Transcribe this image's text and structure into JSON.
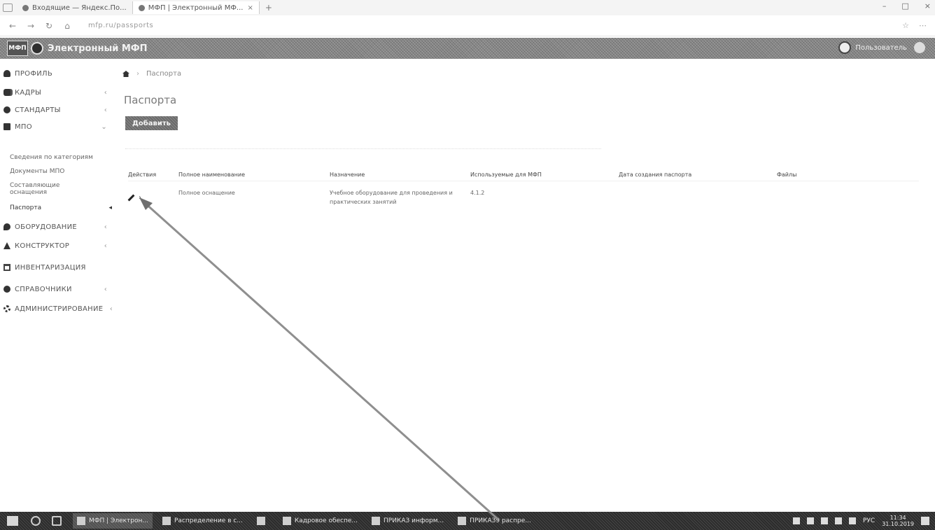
{
  "browser": {
    "tabs": [
      {
        "icon": "mail-icon",
        "label": "Входящие — Яндекс.По..."
      },
      {
        "icon": "app-icon",
        "label": "МФП | Электронный МФ..."
      }
    ],
    "tab_close": "×",
    "new_tab": "+",
    "nav": {
      "back": "←",
      "forward": "→",
      "refresh": "↻",
      "home": "⌂"
    },
    "url": "mfp.ru/passports",
    "addr_right": [
      "☆",
      "⋯"
    ],
    "window_controls": [
      "–",
      "□",
      "×"
    ]
  },
  "header": {
    "logo_text": "МФП",
    "title": "Электронный МФП",
    "user_name": "Пользователь"
  },
  "sidebar": {
    "items": [
      {
        "label": "ПРОФИЛЬ",
        "icon": "user-icon"
      },
      {
        "label": "КАДРЫ",
        "icon": "users-icon",
        "chevron": "‹"
      },
      {
        "label": "СТАНДАРТЫ",
        "icon": "circle-icon",
        "chevron": "‹"
      },
      {
        "label": "МПО",
        "icon": "book-icon",
        "chevron": "⌄"
      },
      {
        "label": "ОБОРУДОВАНИЕ",
        "icon": "chat-icon",
        "chevron": "‹"
      },
      {
        "label": "КОНСТРУКТОР",
        "icon": "tree-icon",
        "chevron": "‹"
      },
      {
        "label": "ИНВЕНТАРИЗАЦИЯ",
        "icon": "calendar-icon"
      },
      {
        "label": "СПРАВОЧНИКИ",
        "icon": "circle-icon",
        "chevron": "‹"
      },
      {
        "label": "АДМИНИСТРИРОВАНИЕ",
        "icon": "gears-icon",
        "chevron": "‹"
      }
    ],
    "sub_items": [
      {
        "label": "Сведения по категориям"
      },
      {
        "label": "Документы МПО"
      },
      {
        "label": "Составляющие оснащения"
      },
      {
        "label": "Паспорта",
        "active": true,
        "marker": "◂"
      }
    ]
  },
  "main": {
    "breadcrumb": {
      "separator": "›",
      "current": "Паспорта"
    },
    "title": "Паспорта",
    "add_button": "Добавить",
    "table": {
      "headers": [
        "Действия",
        "Полное наименование",
        "Назначение",
        "Используемые для МФП",
        "Дата создания паспорта",
        "Файлы"
      ],
      "rows": [
        {
          "view_glyph": "›",
          "name": "Полное оснащение",
          "purpose_line1": "Учебное оборудование для проведения и",
          "purpose_line2": "практических занятий",
          "used_for": "4.1.2",
          "created": "",
          "files": ""
        }
      ]
    }
  },
  "taskbar": {
    "apps": [
      {
        "label": "МФП | Электрон...",
        "active": true
      },
      {
        "label": "Распределение в с..."
      },
      {
        "label": ""
      },
      {
        "label": "Кадровое обеспе..."
      },
      {
        "label": "ПРИКАЗ информ..."
      },
      {
        "label": "ПРИКАЗ9 распре..."
      }
    ],
    "lang": "РУС",
    "time": "11:34",
    "date": "31.10.2019"
  },
  "colors": {
    "header_bg": "#8a8a8a",
    "taskbar_bg": "#2c2c2c",
    "annotation": "#8f8f8f"
  }
}
